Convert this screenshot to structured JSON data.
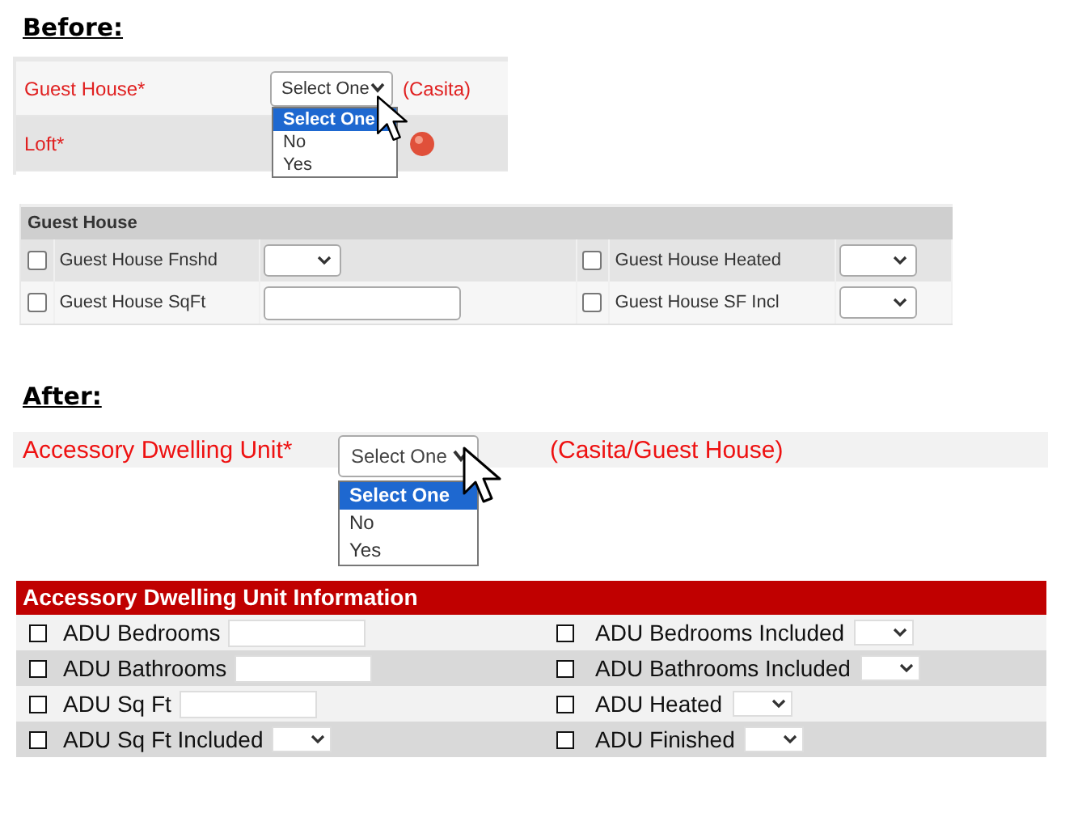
{
  "before": {
    "heading": "Before:",
    "fields": [
      {
        "label": "Guest House*",
        "kind": "select",
        "value": "Select One",
        "note": "(Casita)"
      },
      {
        "label": "Loft*",
        "help": true
      }
    ],
    "dropdown": [
      {
        "label": "Select One",
        "selected": true
      },
      {
        "label": "No",
        "selected": false
      },
      {
        "label": "Yes",
        "selected": false
      }
    ]
  },
  "guest_house": {
    "title": "Guest House",
    "rows": [
      [
        {
          "label": "Guest House Fnshd",
          "checked": false,
          "kind": "select"
        },
        {
          "label": "Guest House Heated",
          "checked": false,
          "kind": "select"
        }
      ],
      [
        {
          "label": "Guest House SqFt",
          "checked": false,
          "kind": "text"
        },
        {
          "label": "Guest House SF Incl",
          "checked": false,
          "kind": "select"
        }
      ]
    ]
  },
  "after": {
    "heading": "After:",
    "field": {
      "label": "Accessory Dwelling Unit*",
      "kind": "select",
      "value": "Select One",
      "note": "(Casita/Guest House)"
    },
    "dropdown": [
      {
        "label": "Select One",
        "selected": true
      },
      {
        "label": "No",
        "selected": false
      },
      {
        "label": "Yes",
        "selected": false
      }
    ]
  },
  "adu_info": {
    "title": "Accessory Dwelling Unit Information",
    "rows": [
      [
        {
          "label": "ADU Bedrooms",
          "checked": false,
          "kind": "text"
        },
        {
          "label": "ADU Bedrooms Included",
          "checked": false,
          "kind": "select"
        }
      ],
      [
        {
          "label": "ADU Bathrooms",
          "checked": false,
          "kind": "text"
        },
        {
          "label": "ADU Bathrooms Included",
          "checked": false,
          "kind": "select"
        }
      ],
      [
        {
          "label": "ADU Sq Ft",
          "checked": false,
          "kind": "text"
        },
        {
          "label": "ADU Heated",
          "checked": false,
          "kind": "select"
        }
      ],
      [
        {
          "label": "ADU Sq Ft Included",
          "checked": false,
          "kind": "select"
        },
        {
          "label": "ADU Finished",
          "checked": false,
          "kind": "select"
        }
      ]
    ]
  }
}
